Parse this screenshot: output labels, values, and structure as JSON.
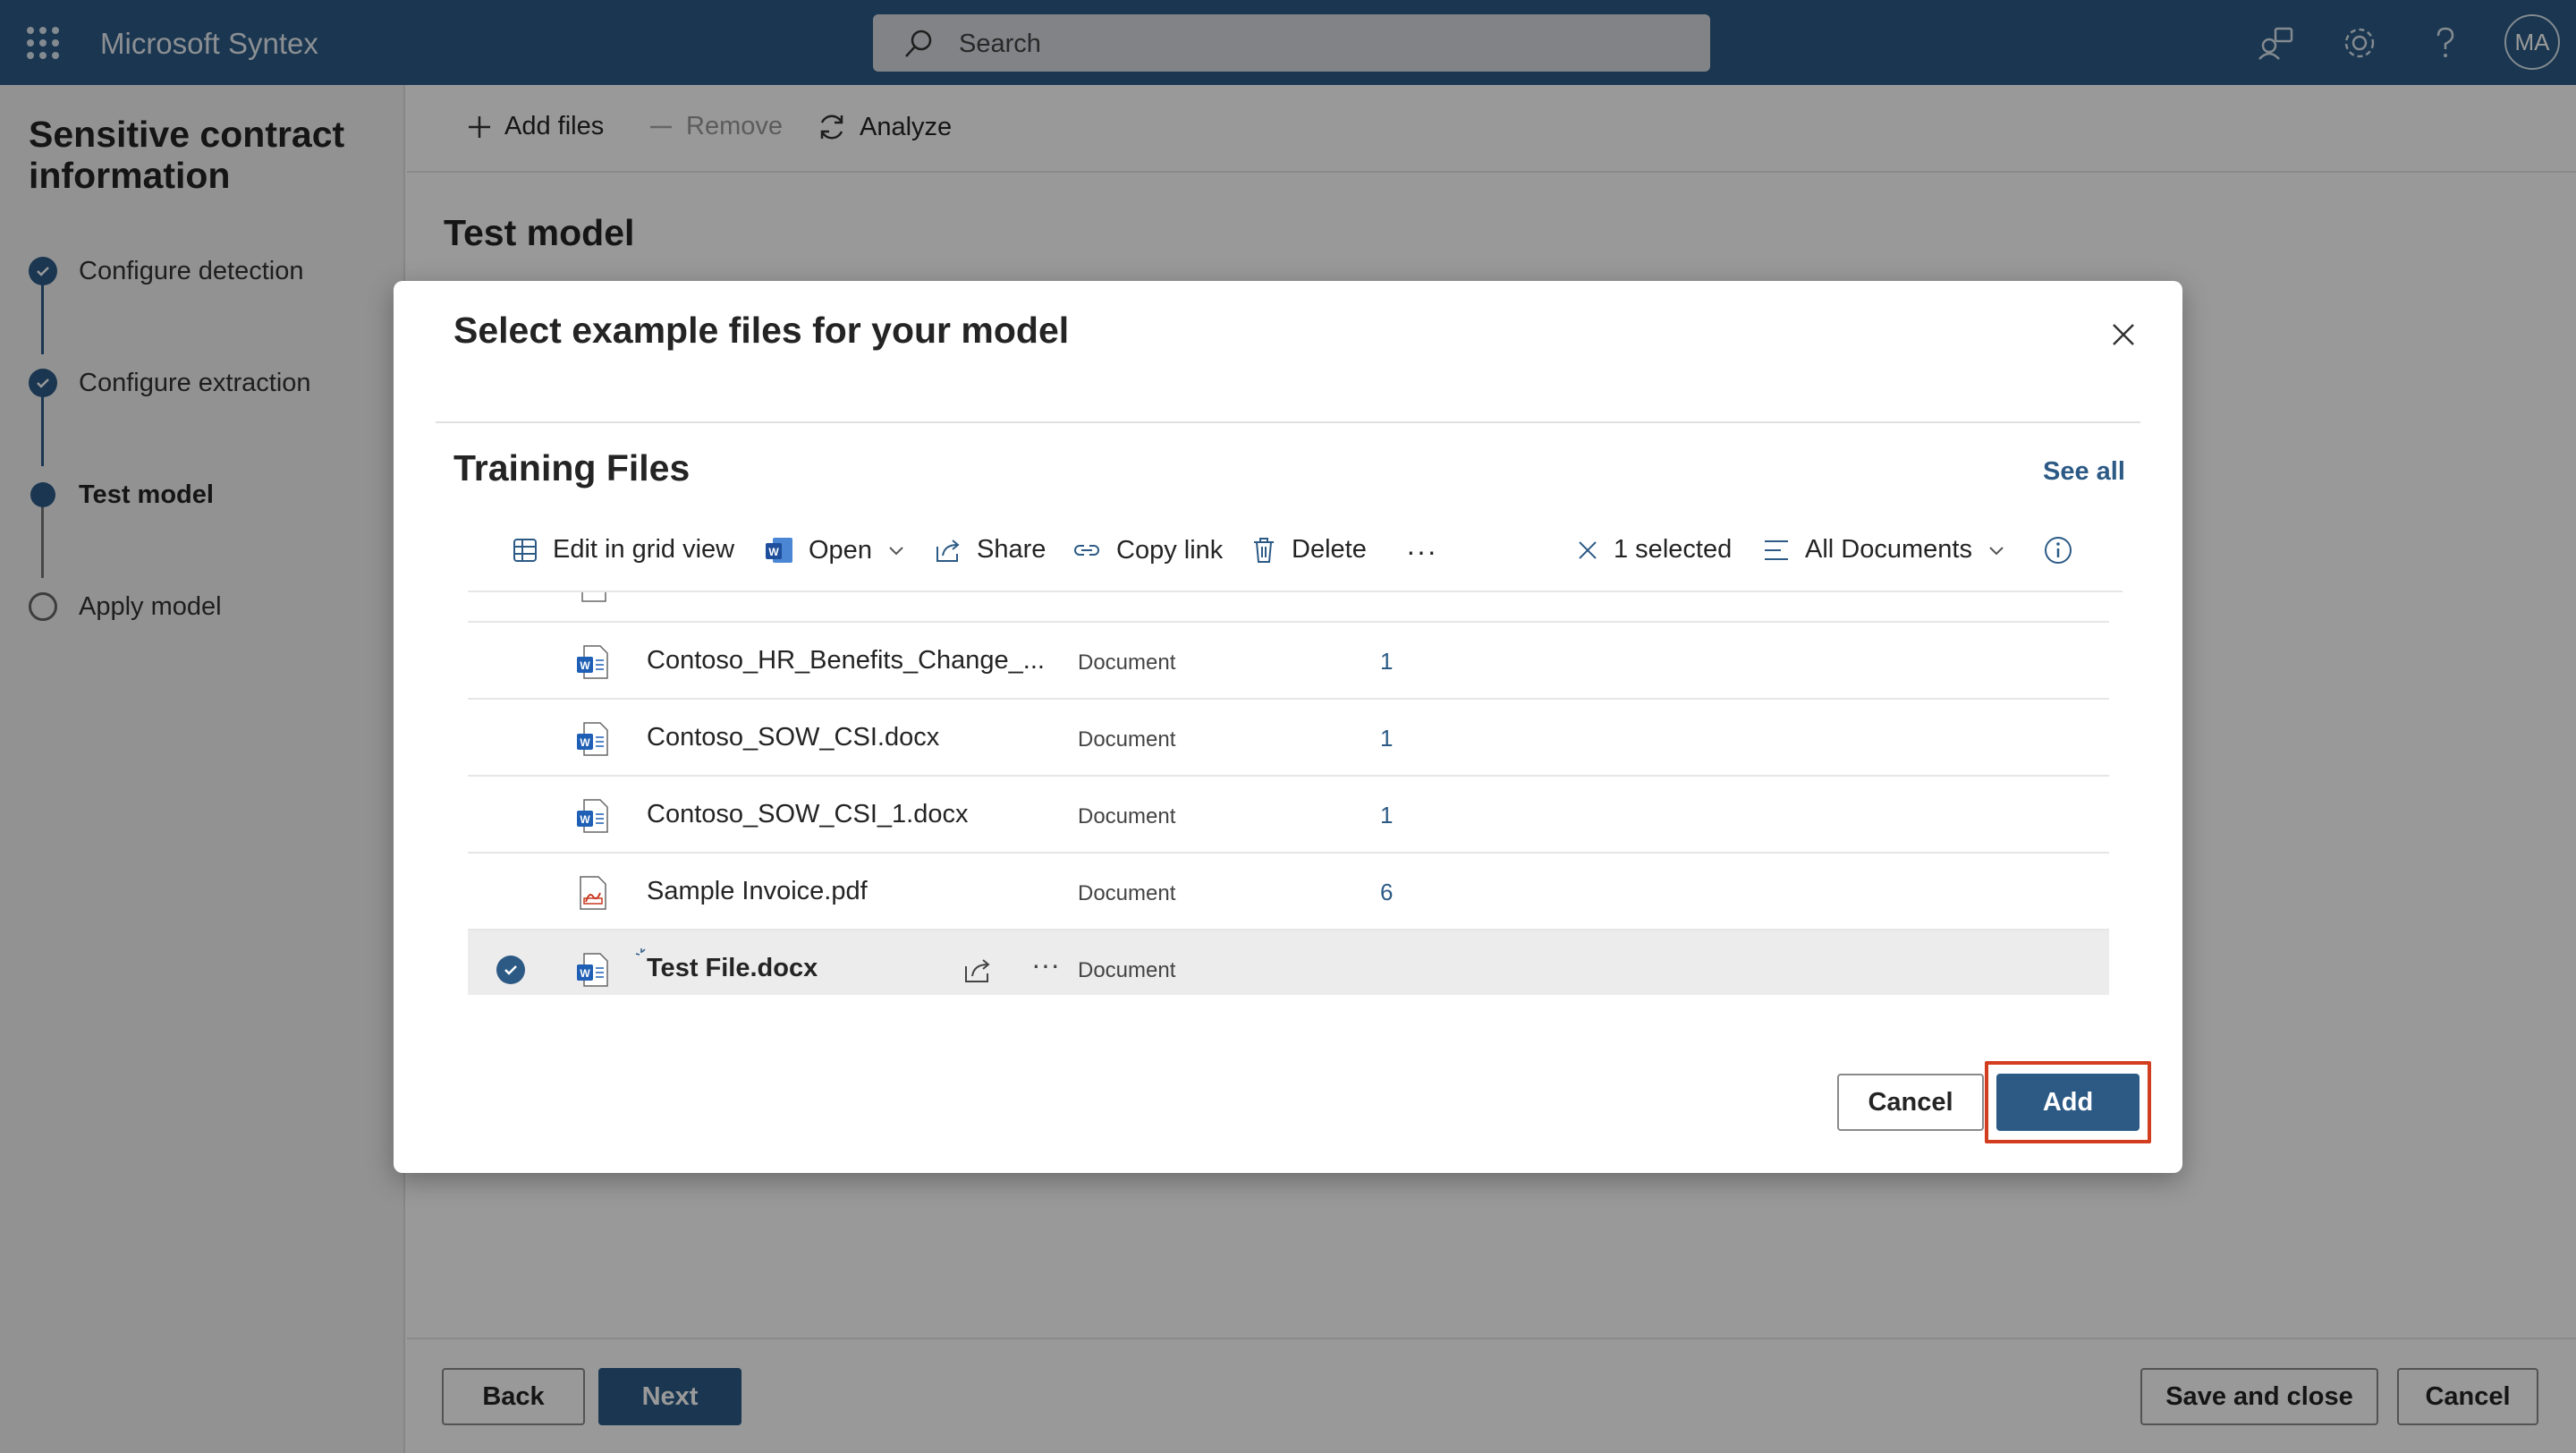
{
  "topbar": {
    "app_title": "Microsoft Syntex",
    "search_placeholder": "Search",
    "avatar_initials": "MA",
    "icons": [
      "app-launcher-icon",
      "share-feedback-icon",
      "gear-icon",
      "help-icon"
    ],
    "background_color": "#2c5a85"
  },
  "leftnav": {
    "title": "Sensitive contract information",
    "steps": [
      {
        "label": "Configure detection",
        "state": "done"
      },
      {
        "label": "Configure extraction",
        "state": "done"
      },
      {
        "label": "Test model",
        "state": "current"
      },
      {
        "label": "Apply model",
        "state": "todo"
      }
    ]
  },
  "main": {
    "commands": {
      "add_files": "Add files",
      "remove": "Remove",
      "analyze": "Analyze"
    },
    "page_title": "Test model",
    "footer": {
      "back": "Back",
      "next": "Next",
      "save_close": "Save and close",
      "cancel": "Cancel"
    }
  },
  "dialog": {
    "title": "Select example files for your model",
    "section_title": "Training Files",
    "see_all": "See all",
    "toolbar": {
      "edit_grid": "Edit in grid view",
      "open": "Open",
      "share": "Share",
      "copy_link": "Copy link",
      "delete": "Delete",
      "more": "···",
      "selected": "1 selected",
      "view": "All Documents"
    },
    "files": [
      {
        "name": "Contoso_HR_Benefits_Change_...",
        "type": "Document",
        "count": "1",
        "icon": "word-icon",
        "selected": false
      },
      {
        "name": "Contoso_SOW_CSI.docx",
        "type": "Document",
        "count": "1",
        "icon": "word-icon",
        "selected": false
      },
      {
        "name": "Contoso_SOW_CSI_1.docx",
        "type": "Document",
        "count": "1",
        "icon": "word-icon",
        "selected": false
      },
      {
        "name": "Sample Invoice.pdf",
        "type": "Document",
        "count": "6",
        "icon": "pdf-icon",
        "selected": false
      },
      {
        "name": "Test File.docx",
        "type": "Document",
        "count": "",
        "icon": "word-icon",
        "selected": true
      }
    ],
    "row_more": "···",
    "cancel": "Cancel",
    "add": "Add",
    "highlight_color": "#d23d1f",
    "accent_color": "#2c5a85"
  }
}
